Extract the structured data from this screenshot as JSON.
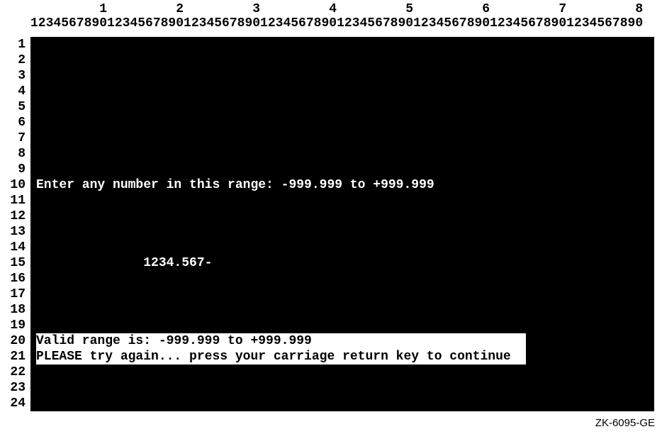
{
  "ruler": {
    "tens_positions": [
      1,
      2,
      3,
      4,
      5,
      6,
      7,
      8
    ],
    "unit_pattern": "1234567890",
    "columns": 80,
    "rows": 24
  },
  "terminal": {
    "row_count": 24,
    "lines": {
      "10": "Enter any number in this range: -999.999 to +999.999",
      "15_col": 15,
      "15": "1234.567-",
      "20": "Valid range is: -999.999 to +999.999",
      "21": "PLEASE try again... press your carriage return key to continue"
    },
    "inverse_rows": [
      20,
      21
    ]
  },
  "footer": {
    "label": "ZK-6095-GE"
  }
}
